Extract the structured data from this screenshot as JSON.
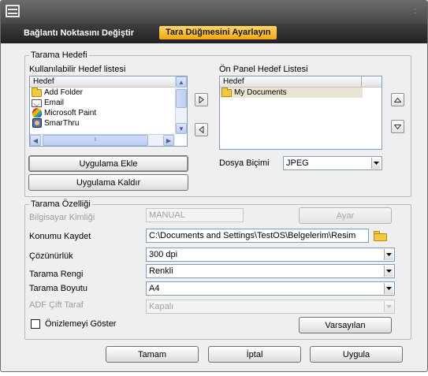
{
  "tabs": {
    "tab1": "Bağlantı Noktasını Değiştir",
    "tab2": "Tara Düğmesini Ayarlayın"
  },
  "scan_target": {
    "legend": "Tarama Hedefi",
    "available_label": "Kullanılabilir Hedef listesi",
    "available_header": "Hedef",
    "available_items": [
      "Add Folder",
      "Email",
      "Microsoft Paint",
      "SmarThru"
    ],
    "front_panel_label": "Ön Panel Hedef Listesi",
    "front_panel_header": "Hedef",
    "front_panel_items": [
      "My Documents"
    ],
    "add_app_button": "Uygulama Ekle",
    "remove_app_button": "Uygulama Kaldır",
    "file_format_label": "Dosya Biçimi",
    "file_format_value": "JPEG"
  },
  "scan_props": {
    "legend": "Tarama Özelliği",
    "computer_id_label": "Bilgisayar Kimliği",
    "computer_id_value": "MANUAL",
    "settings_button": "Ayar",
    "save_location_label": "Konumu Kaydet",
    "save_location_value": "C:\\Documents and Settings\\TestOS\\Belgelerim\\Resim",
    "resolution_label": "Çözünürlük",
    "resolution_value": "300 dpi",
    "color_label": "Tarama Rengi",
    "color_value": "Renkli",
    "size_label": "Tarama Boyutu",
    "size_value": "A4",
    "adf_label": "ADF Çift Taraf",
    "adf_value": "Kapalı",
    "preview_label": "Önizlemeyi Göster",
    "preview_checked": false,
    "defaults_button": "Varsayılan"
  },
  "footer": {
    "ok": "Tamam",
    "cancel": "İptal",
    "apply": "Uygula"
  },
  "icons": {
    "move_right": "chevron-right-icon",
    "move_left": "chevron-left-icon",
    "move_up": "triangle-up-icon",
    "move_down": "triangle-down-icon"
  },
  "colors": {
    "active_tab": "#f4a712",
    "title_bar": "#474747",
    "tab_bar": "#222222"
  }
}
